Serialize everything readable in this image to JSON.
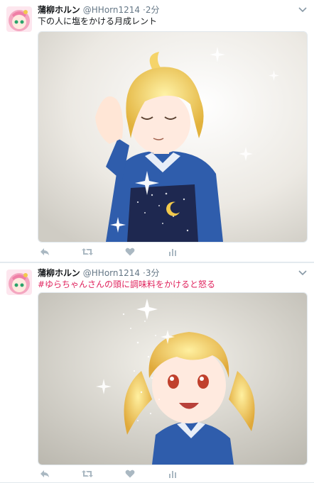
{
  "tweets": [
    {
      "name": "蒲柳ホルン",
      "handle": "@HHorn1214",
      "time": "2分",
      "text": "下の人に塩をかける月成レント",
      "image_alt": "blond character with eyes closed sprinkling sparkling salt"
    },
    {
      "name": "蒲柳ホルン",
      "handle": "@HHorn1214",
      "time": "3分",
      "text": "#ゆらちゃんさんの頭に調味料をかけると怒る",
      "image_alt": "blond girl with twin tails and sparkles falling on her head"
    }
  ],
  "icons": [
    "reply-icon",
    "retweet-icon",
    "like-icon",
    "analytics-icon",
    "caret-down-icon"
  ],
  "colors": {
    "background": "#e6ecf0",
    "hashtag": "#e0245e",
    "muted": "#657786",
    "icon": "#aab8c2"
  }
}
